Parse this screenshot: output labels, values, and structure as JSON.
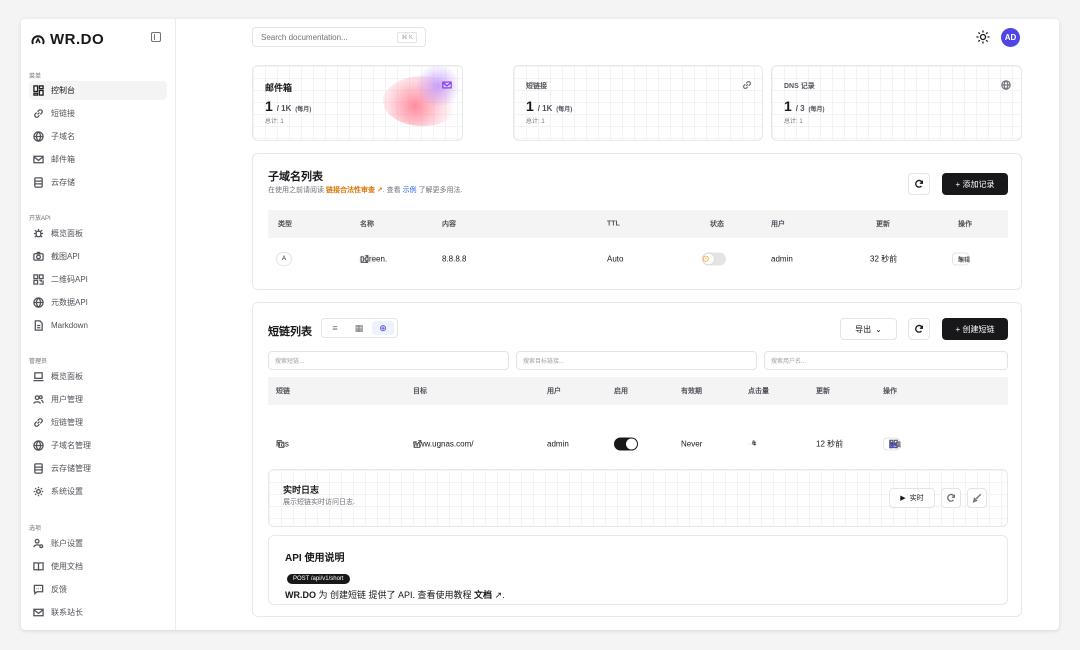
{
  "app": {
    "logo": "WR.DO"
  },
  "search": {
    "placeholder": "Search documentation...",
    "shortcut": "⌘ K"
  },
  "user": {
    "initials": "AD"
  },
  "sidebar": {
    "groups": [
      {
        "title": "菜单",
        "items": [
          "控制台",
          "短链接",
          "子域名",
          "邮件箱",
          "云存储"
        ]
      },
      {
        "title": "开放API",
        "items": [
          "概览面板",
          "截图API",
          "二维码API",
          "元数据API",
          "Markdown"
        ]
      },
      {
        "title": "管理员",
        "items": [
          "概览面板",
          "用户管理",
          "短链管理",
          "子域名管理",
          "云存储管理",
          "系统设置"
        ]
      },
      {
        "title": "选项",
        "items": [
          "账户设置",
          "使用文档",
          "反馈",
          "联系站长"
        ]
      }
    ]
  },
  "stats": [
    {
      "title": "邮件箱",
      "value": "1",
      "unit": "/ 1K",
      "period": "(每月)",
      "total": "总计: 1",
      "icon": "mail-icon"
    },
    {
      "title": "短链接",
      "value": "1",
      "unit": "/ 1K",
      "period": "(每月)",
      "total": "总计: 1",
      "icon": "link-icon"
    },
    {
      "title": "DNS 记录",
      "value": "1",
      "unit": "/ 3",
      "period": "(每月)",
      "total": "总计: 1",
      "icon": "globe-icon"
    }
  ],
  "subdomains": {
    "title": "子域名列表",
    "desc_pre": "在使用之前请阅读",
    "desc_hl": "链接合法性审查",
    "desc_mid": ". 查看",
    "desc_link": "示例",
    "desc_post": "了解更多用法.",
    "add_label": "+ 添加记录",
    "columns": [
      "类型",
      "名称",
      "内容",
      "TTL",
      "状态",
      "用户",
      "更新",
      "操作"
    ],
    "rows": [
      {
        "type": "A",
        "name": "ugreen.",
        "name_blur": "xxxx",
        "name_suffix": ".",
        "content": "8.8.8.8",
        "ttl": "Auto",
        "user": "admin",
        "updated": "32 秒前",
        "action": "编辑"
      }
    ]
  },
  "shortlinks": {
    "title": "短链列表",
    "export_label": "导出",
    "create_label": "+ 创建短链",
    "search_placeholders": [
      "搜索短链...",
      "搜索目标链接...",
      "搜索用户名..."
    ],
    "columns": [
      "短链",
      "目标",
      "用户",
      "启用",
      "有效期",
      "点击量",
      "更新",
      "操作"
    ],
    "rows": [
      {
        "slug": "nas",
        "target": "www.ugnas.com/",
        "user": "admin",
        "expiry": "Never",
        "clicks": "0",
        "updated": "12 秒前",
        "action": "编辑"
      }
    ]
  },
  "logs": {
    "title": "实时日志",
    "desc": "展示短链实时访问日志.",
    "realtime_label": "实时"
  },
  "api": {
    "title": "API 使用说明",
    "endpoint": "POST /api/v1/short",
    "brand": "WR.DO",
    "text_mid": "为 创建短链 提供了 API. 查看使用教程",
    "docs": "文档",
    "text_end": "."
  }
}
